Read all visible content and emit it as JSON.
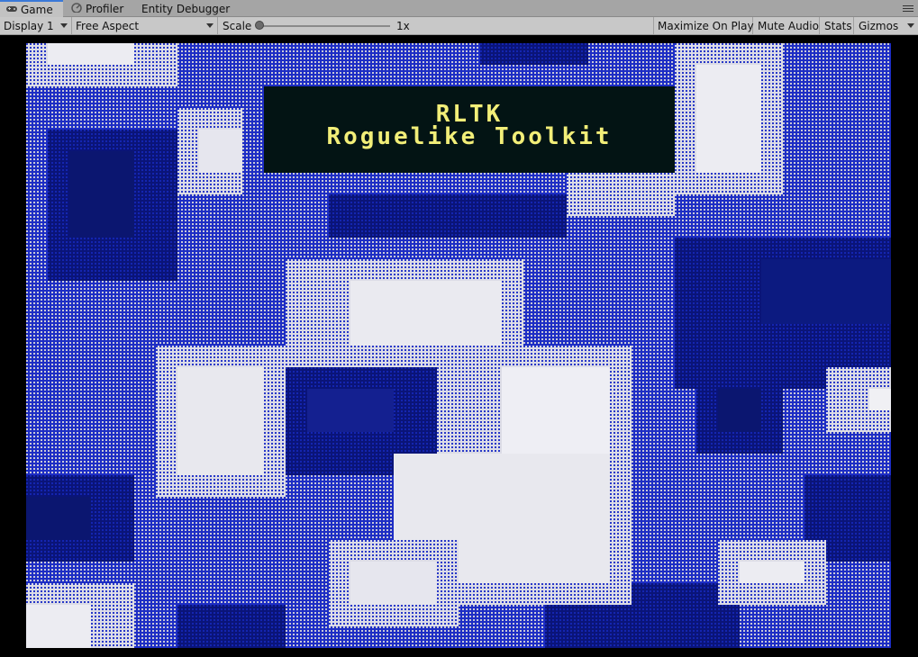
{
  "tabs": [
    {
      "label": "Game",
      "icon": "gamepad-icon",
      "active": true
    },
    {
      "label": "Profiler",
      "icon": "profiler-icon",
      "active": false
    },
    {
      "label": "Entity Debugger",
      "icon": "",
      "active": false
    }
  ],
  "toolbar": {
    "display": "Display 1",
    "aspect": "Free Aspect",
    "scale_label": "Scale",
    "scale_value": "1x",
    "maximize": "Maximize On Play",
    "mute": "Mute Audio",
    "stats": "Stats",
    "gizmos": "Gizmos"
  },
  "game": {
    "title": "RLTK",
    "subtitle": "Roguelike Toolkit",
    "colors": {
      "title_bg": "#031414",
      "title_text": "#f2ee78",
      "dark_blue": "#0d1a7a",
      "mid_blue": "#2233c0",
      "light": "#e8e8ee"
    }
  }
}
